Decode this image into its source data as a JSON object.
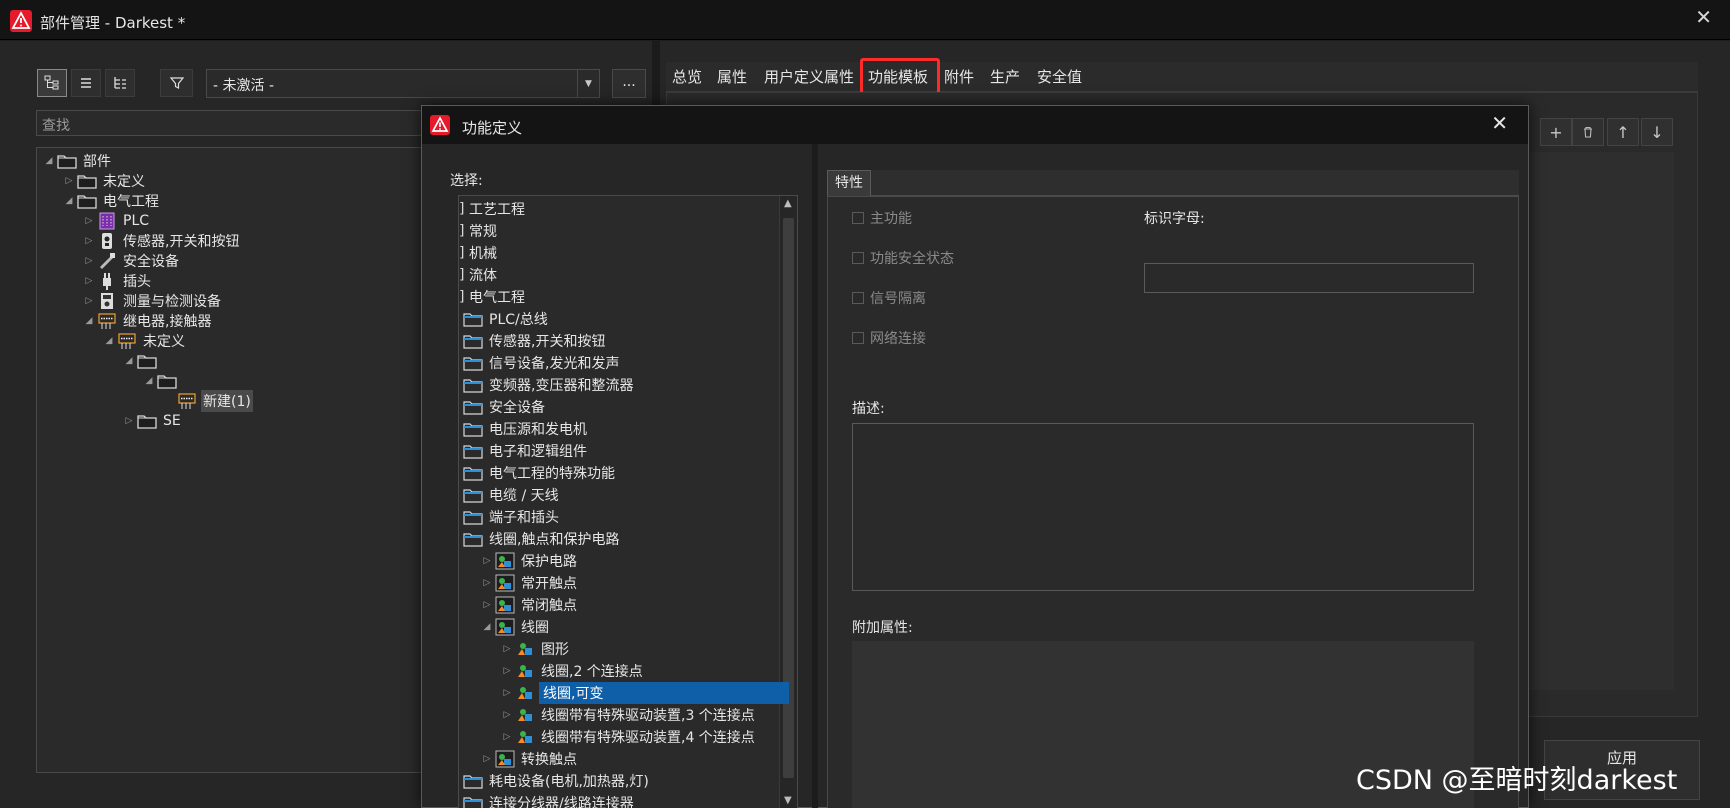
{
  "window": {
    "title": "部件管理 - Darkest *"
  },
  "toolbar": {
    "filter_value": "- 未激活 -",
    "more_label": "...",
    "search_placeholder": "查找"
  },
  "left_tree": [
    {
      "label": "部件",
      "icon": "folder-icon"
    },
    {
      "label": "未定义",
      "icon": "folder-icon"
    },
    {
      "label": "电气工程",
      "icon": "folder-icon"
    },
    {
      "label": "PLC",
      "icon": "plc-icon"
    },
    {
      "label": "传感器,开关和按钮",
      "icon": "sensor-icon"
    },
    {
      "label": "安全设备",
      "icon": "safety-icon"
    },
    {
      "label": "插头",
      "icon": "plug-icon"
    },
    {
      "label": "测量与检测设备",
      "icon": "meter-icon"
    },
    {
      "label": "继电器,接触器",
      "icon": "relay-icon"
    },
    {
      "label": "未定义",
      "icon": "relay-icon"
    },
    {
      "label": "",
      "icon": "folder-icon"
    },
    {
      "label": "",
      "icon": "folder-icon"
    },
    {
      "label": "新建(1)",
      "icon": "relay-icon"
    },
    {
      "label": "SE",
      "icon": "folder-icon"
    }
  ],
  "tabs": [
    "总览",
    "属性",
    "用户定义属性",
    "功能模板",
    "附件",
    "生产",
    "安全值"
  ],
  "apply_label": "应用",
  "dialog": {
    "title": "功能定义",
    "select_label": "选择:",
    "tree": [
      {
        "label": "工艺工程"
      },
      {
        "label": "常规"
      },
      {
        "label": "机械"
      },
      {
        "label": "流体"
      },
      {
        "label": "电气工程"
      },
      {
        "label": "PLC/总线"
      },
      {
        "label": "传感器,开关和按钮"
      },
      {
        "label": "信号设备,发光和发声"
      },
      {
        "label": "变频器,变压器和整流器"
      },
      {
        "label": "安全设备"
      },
      {
        "label": "电压源和发电机"
      },
      {
        "label": "电子和逻辑组件"
      },
      {
        "label": "电气工程的特殊功能"
      },
      {
        "label": "电缆 / 天线"
      },
      {
        "label": "端子和插头"
      },
      {
        "label": "线圈,触点和保护电路"
      },
      {
        "label": "保护电路"
      },
      {
        "label": "常开触点"
      },
      {
        "label": "常闭触点"
      },
      {
        "label": "线圈"
      },
      {
        "label": "图形"
      },
      {
        "label": "线圈,2 个连接点"
      },
      {
        "label": "线圈,可变"
      },
      {
        "label": "线圈带有特殊驱动装置,3 个连接点"
      },
      {
        "label": "线圈带有特殊驱动装置,4 个连接点"
      },
      {
        "label": "转换触点"
      },
      {
        "label": "耗电设备(电机,加热器,灯)"
      },
      {
        "label": "连接分线器/线路连接器"
      }
    ],
    "props_tab": "特性",
    "checkboxes": [
      "主功能",
      "功能安全状态",
      "信号隔离",
      "网络连接"
    ],
    "id_letter_label": "标识字母:",
    "description_label": "描述:",
    "extra_props_label": "附加属性:"
  },
  "watermark": "CSDN @至暗时刻darkest",
  "colors": {
    "accent_red": "#e51a2b",
    "selection_blue": "#0e5ea8",
    "highlight_box": "#ff2a2a"
  }
}
